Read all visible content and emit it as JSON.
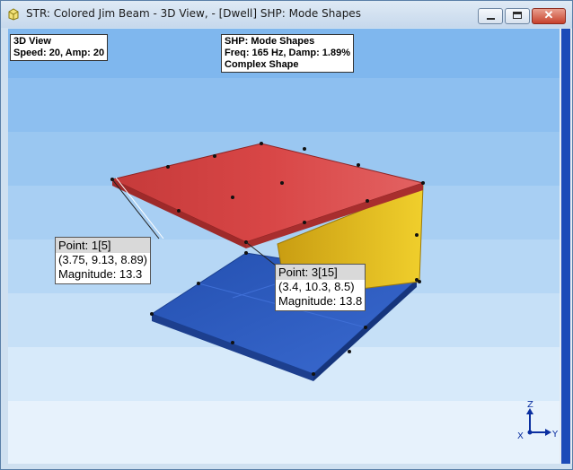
{
  "window": {
    "title": "STR: Colored Jim Beam - 3D View,  - [Dwell] SHP: Mode Shapes",
    "buttons": {
      "minimize": "minimize",
      "maximize": "maximize",
      "close": "✕"
    }
  },
  "view_info": {
    "line1": "3D View",
    "line2": "Speed: 20, Amp: 20"
  },
  "shape_info": {
    "line1": "SHP: Mode Shapes",
    "line2": "Freq: 165 Hz, Damp: 1.89%",
    "line3": "Complex Shape"
  },
  "tooltips": [
    {
      "point": "Point: 1[5]",
      "coords": "(3.75, 9.13, 8.89)",
      "magnitude": "Magnitude: 13.3"
    },
    {
      "point": "Point: 3[15]",
      "coords": "(3.4, 10.3, 8.5)",
      "magnitude": "Magnitude: 13.8"
    }
  ],
  "axes": {
    "z": "Z",
    "y": "Y",
    "x": "X"
  },
  "colors": {
    "top_plate": "#d23c3c",
    "side_plate": "#e8c21f",
    "bottom_plate": "#2a57b8",
    "background_top": "#7fb7ee",
    "background_bottom": "#e7f2fc",
    "axis_triad": "#0b2fa0"
  }
}
